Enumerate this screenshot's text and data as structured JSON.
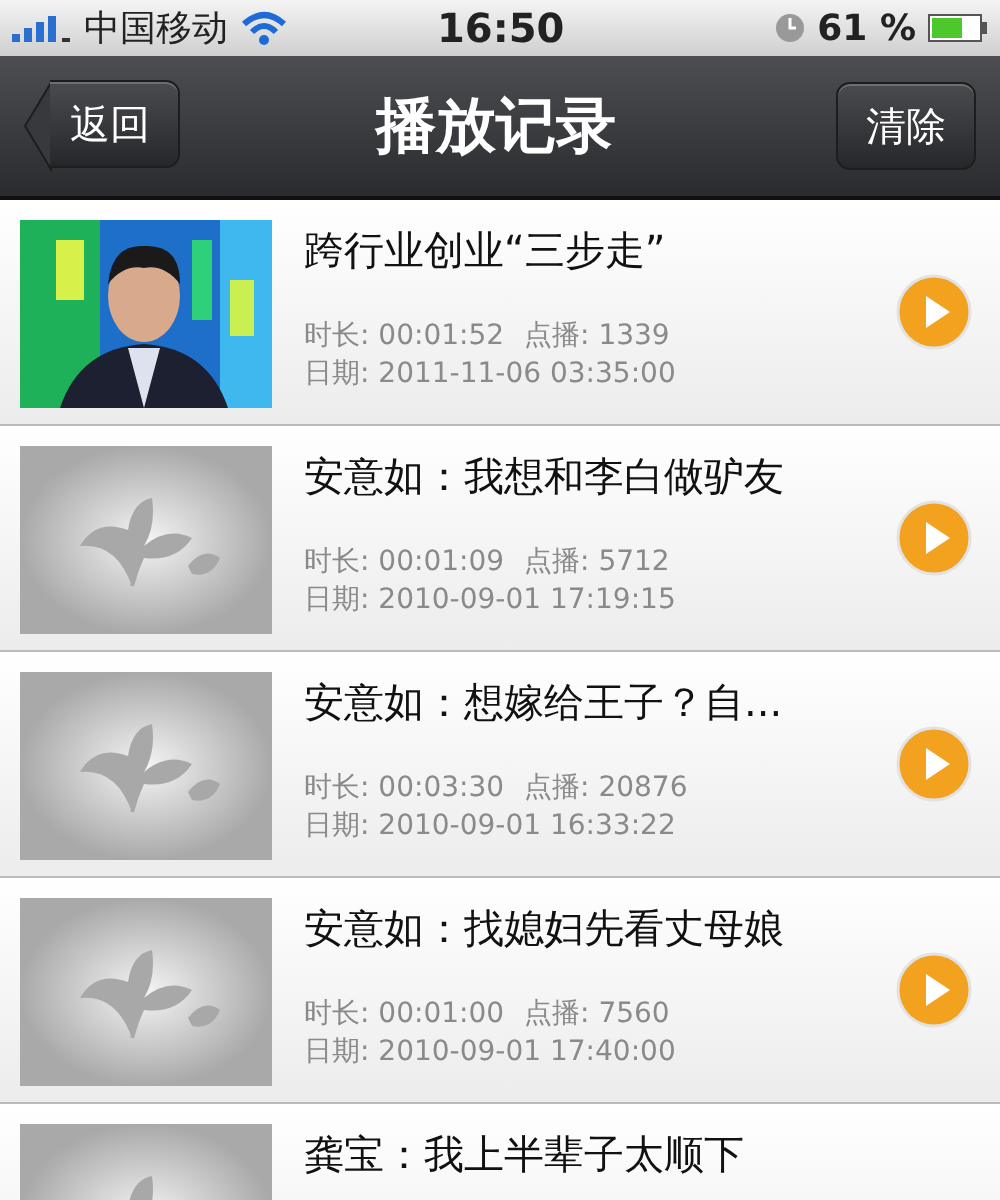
{
  "status_bar": {
    "carrier": "中国移动",
    "time": "16:50",
    "battery": "61 %"
  },
  "nav_bar": {
    "back": "返回",
    "title": "播放记录",
    "action": "清除"
  },
  "records": [
    {
      "kind": "picture",
      "title": "跨行业创业“三步走”",
      "duration": "时长: 00:01:52",
      "plays": "点播: 1339",
      "date": "日期: 2011-11-06 03:35:00"
    },
    {
      "kind": "placeholder",
      "title": "安意如：我想和李白做驴友",
      "duration": "时长: 00:01:09",
      "plays": "点播: 5712",
      "date": "日期: 2010-09-01 17:19:15"
    },
    {
      "kind": "placeholder",
      "title": "安意如：想嫁给王子？自...",
      "duration": "时长: 00:03:30",
      "plays": "点播: 20876",
      "date": "日期: 2010-09-01 16:33:22"
    },
    {
      "kind": "placeholder",
      "title": "安意如：找媳妇先看丈母娘",
      "duration": "时长: 00:01:00",
      "plays": "点播: 7560",
      "date": "日期: 2010-09-01 17:40:00"
    },
    {
      "kind": "placeholder",
      "title": "龚宝：我上半辈子太顺下"
    }
  ]
}
